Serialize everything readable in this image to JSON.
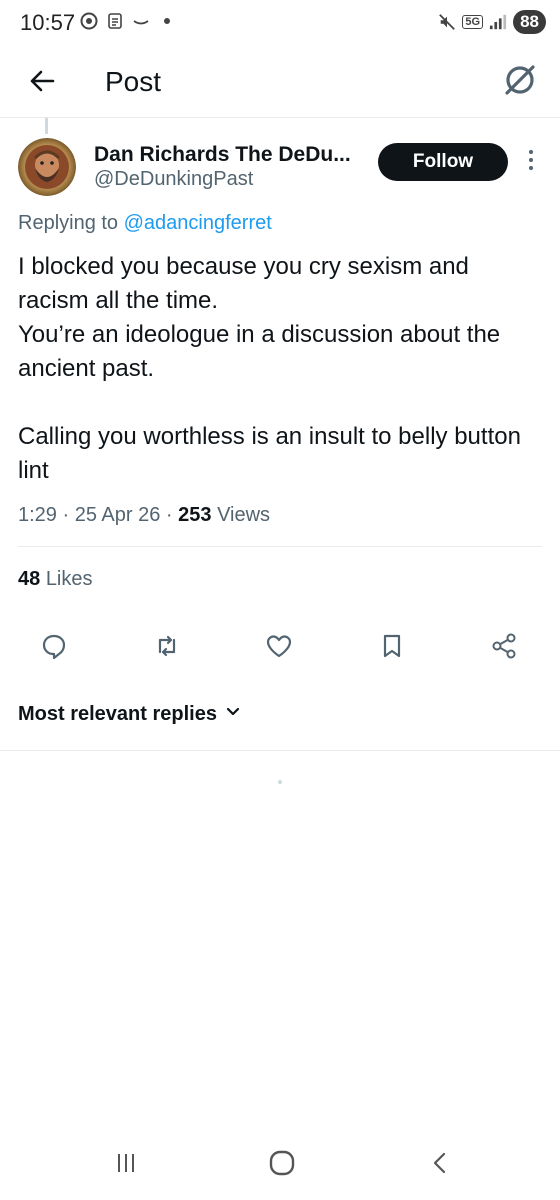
{
  "status_bar": {
    "time": "10:57",
    "network": "5G",
    "battery": "88"
  },
  "header": {
    "title": "Post"
  },
  "post": {
    "author_name": "Dan Richards The DeDu...",
    "author_handle": "@DeDunkingPast",
    "follow_label": "Follow",
    "replying_prefix": "Replying to",
    "replying_to": "@adancingferret",
    "body_lines": [
      "I blocked you because you cry sexism and racism all the time.",
      "You’re an ideologue in a discussion about the ancient past.",
      "Calling you worthless is an insult to belly button lint"
    ],
    "time": "1:29",
    "date": "25 Apr 26",
    "views_count": "253",
    "views_label": "Views",
    "likes_count": "48",
    "likes_label": "Likes"
  },
  "replies": {
    "sort_label": "Most relevant replies"
  },
  "icons": {
    "back": "arrow-left-icon",
    "logo": "x-logo-icon",
    "more": "more-vertical-icon",
    "reply": "reply-icon",
    "repost": "repost-icon",
    "like": "heart-icon",
    "bookmark": "bookmark-icon",
    "share": "share-icon"
  },
  "colors": {
    "accent": "#1d9bf0",
    "text": "#0f1419",
    "secondary": "#536471",
    "follow_bg": "#0f1419"
  }
}
